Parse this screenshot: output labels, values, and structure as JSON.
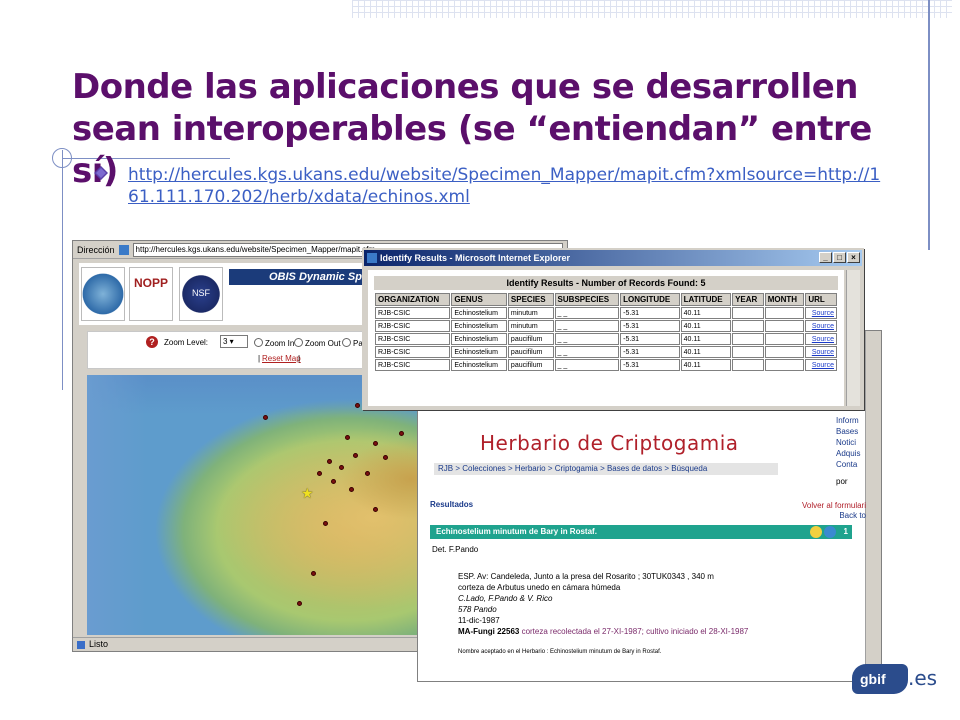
{
  "slide": {
    "title": "Donde las aplicaciones que se desarrollen sean interoperables (se “entiendan” entre sí)",
    "link": "http://hercules.kgs.ukans.edu/website/Specimen_Mapper/mapit.cfm?xmlsource=http://161.111.170.202/herb/xdata/echinos.xml",
    "colors": {
      "title": "#5b0f6b",
      "link": "#3b5fc4",
      "accent": "#7d8fc4"
    }
  },
  "obis_window": {
    "address_label": "Dirección",
    "address": "http://hercules.kgs.ukans.edu/website/Specimen_Mapper/mapit.cfm",
    "banner_title": "OBIS Dynamic Spe",
    "logo_nopp": "NOPP",
    "logo_nsf": "NSF",
    "zoom_label": "Zoom Level:",
    "zoom_value": "3",
    "zoom_in": "Zoom In",
    "zoom_out": "Zoom Out",
    "pan": "Pan",
    "reset_prefix": "|",
    "reset": "Reset Map",
    "reset_suffix": "|",
    "status": "Listo"
  },
  "identify_window": {
    "title": "Identify Results - Microsoft Internet Explorer",
    "header": "Identify Results - Number of Records Found: 5",
    "columns": [
      "ORGANIZATION",
      "GENUS",
      "SPECIES",
      "SUBSPECIES",
      "LONGITUDE",
      "LATITUDE",
      "YEAR",
      "MONTH",
      "URL"
    ],
    "rows": [
      [
        "RJB-CSIC",
        "Echinostelium",
        "minutum",
        "_ _",
        "-5.31",
        "40.11",
        "",
        "",
        "Source"
      ],
      [
        "RJB-CSIC",
        "Echinostelium",
        "minutum",
        "_ _",
        "-5.31",
        "40.11",
        "",
        "",
        "Source"
      ],
      [
        "RJB-CSIC",
        "Echinostelium",
        "paucifilum",
        "_ _",
        "-5.31",
        "40.11",
        "",
        "",
        "Source"
      ],
      [
        "RJB-CSIC",
        "Echinostelium",
        "paucifilum",
        "_ _",
        "-5.31",
        "40.11",
        "",
        "",
        "Source"
      ],
      [
        "RJB-CSIC",
        "Echinostelium",
        "paucifilum",
        "_ _",
        "-5.31",
        "40.11",
        "",
        "",
        "Source"
      ]
    ]
  },
  "herbario_window": {
    "title": "Herbario de Criptogamia",
    "breadcrumb": "RJB > Colecciones > Herbario > Criptogamia > Bases de datos > Búsqueda",
    "right_links": [
      "Inform",
      "Bases",
      "Notici",
      "Adquis",
      "Conta"
    ],
    "por": "por",
    "results_label": "Resultados",
    "volver": "Volver al formulari",
    "back": "Back to",
    "record_title": "Echinostelium minutum  de Bary in Rostaf.",
    "record_number": "1",
    "det": "Det. F.Pando",
    "locality": "ESP. Av: Candeleda, Junto a la presa del Rosarito ; 30TUK0343 , 340 m",
    "substrate": "corteza de Arbutus unedo en cámara húmeda",
    "collectors": "C.Lado, F.Pando & V. Rico",
    "collector_number": "578 Pando",
    "date": "11-dic-1987",
    "herbarium_code": "MA-Fungi  22563",
    "herbarium_note": " corteza recolectada el 27-XI-1987; cultivo iniciado el 28-XI-1987",
    "accepted_name": "Nombre aceptado en el Herbario : Echinostelium minutum de Bary in Rostaf."
  },
  "footer": {
    "logo_text": "gbif",
    "suffix": ".es"
  }
}
